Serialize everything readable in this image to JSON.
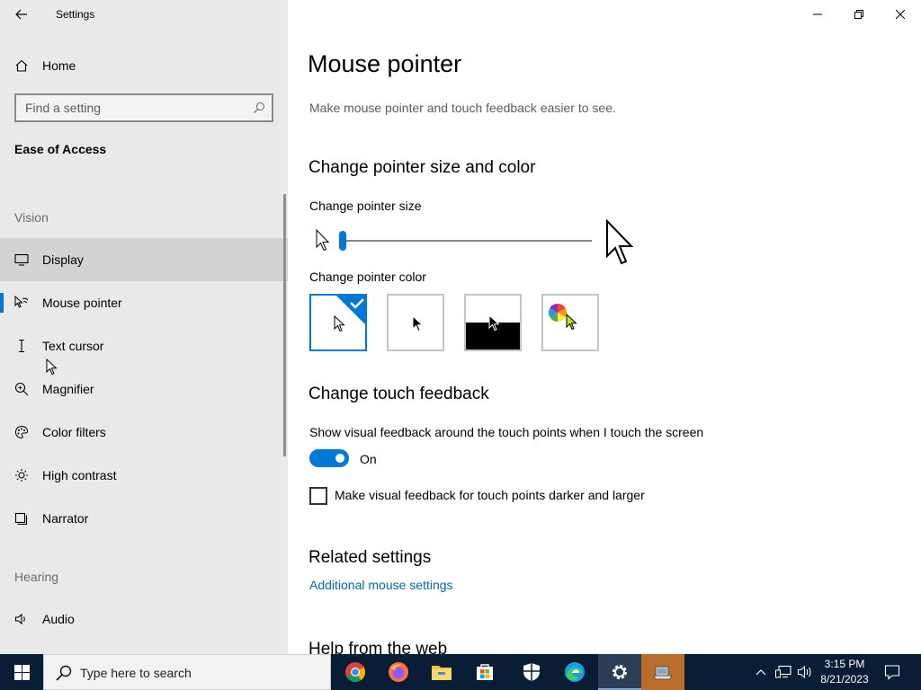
{
  "window": {
    "title": "Settings"
  },
  "sidebar": {
    "home_label": "Home",
    "search_placeholder": "Find a setting",
    "section_title": "Ease of Access",
    "groups": {
      "vision": "Vision",
      "hearing": "Hearing"
    },
    "items": [
      {
        "label": "Display",
        "icon": "monitor-icon"
      },
      {
        "label": "Mouse pointer",
        "icon": "mouse-pointer-icon",
        "selected": true
      },
      {
        "label": "Text cursor",
        "icon": "text-cursor-icon"
      },
      {
        "label": "Magnifier",
        "icon": "magnifier-icon"
      },
      {
        "label": "Color filters",
        "icon": "color-filters-icon"
      },
      {
        "label": "High contrast",
        "icon": "high-contrast-icon"
      },
      {
        "label": "Narrator",
        "icon": "narrator-icon"
      },
      {
        "label": "Audio",
        "icon": "audio-icon"
      }
    ]
  },
  "main": {
    "title": "Mouse pointer",
    "description": "Make mouse pointer and touch feedback easier to see.",
    "size_color": {
      "heading": "Change pointer size and color",
      "size_label": "Change pointer size",
      "size_value": 1,
      "color_label": "Change pointer color",
      "color_options": [
        "white",
        "black",
        "inverted",
        "custom"
      ],
      "selected_color": "white"
    },
    "touch": {
      "heading": "Change touch feedback",
      "show_label": "Show visual feedback around the touch points when I touch the screen",
      "toggle_state": "On",
      "checkbox_label": "Make visual feedback for touch points darker and larger",
      "checkbox_checked": false
    },
    "related": {
      "heading": "Related settings",
      "link": "Additional mouse settings"
    },
    "help": {
      "heading": "Help from the web"
    }
  },
  "taskbar": {
    "search_placeholder": "Type here to search",
    "apps": [
      "chrome-icon",
      "firefox-icon",
      "file-explorer-icon",
      "store-icon",
      "security-icon",
      "edge-icon",
      "settings-icon",
      "app-icon"
    ],
    "time": "3:15 PM",
    "date": "8/21/2023"
  },
  "colors": {
    "accent": "#0078d7",
    "sidebar_bg": "#e9e9e9",
    "taskbar_bg": "#0a1d36",
    "link": "#0067b8"
  }
}
